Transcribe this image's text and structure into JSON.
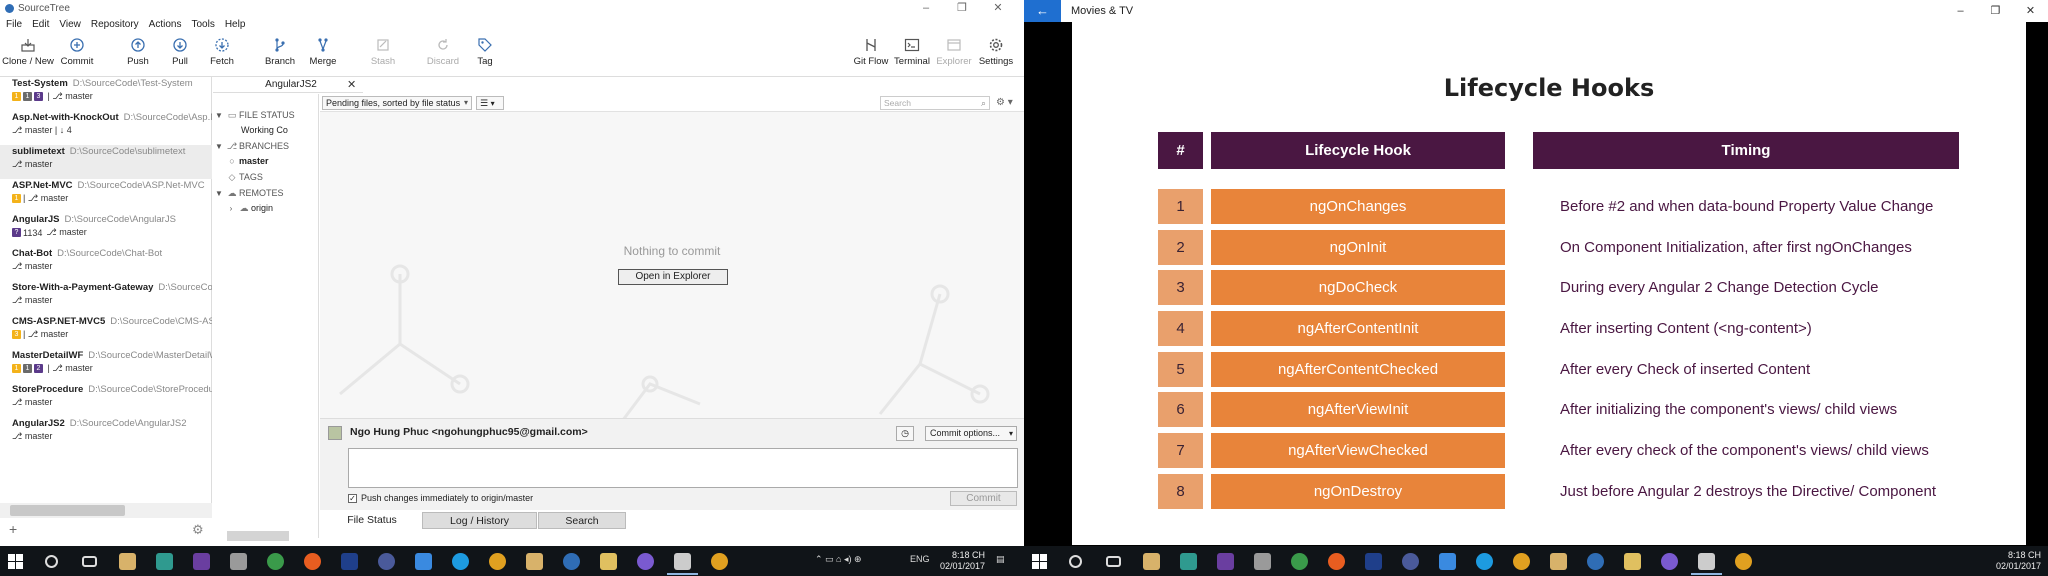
{
  "sourcetree": {
    "window_title": "SourceTree",
    "window_controls": [
      "–",
      "❐",
      "✕"
    ],
    "menu": [
      "File",
      "Edit",
      "View",
      "Repository",
      "Actions",
      "Tools",
      "Help"
    ],
    "toolbar": {
      "left": [
        {
          "label": "Clone / New",
          "icon": "clone-icon"
        },
        {
          "label": "Commit",
          "icon": "commit-icon"
        },
        {
          "label": "Push",
          "icon": "push-icon"
        },
        {
          "label": "Pull",
          "icon": "pull-icon"
        },
        {
          "label": "Fetch",
          "icon": "fetch-icon"
        },
        {
          "label": "Branch",
          "icon": "branch-icon"
        },
        {
          "label": "Merge",
          "icon": "merge-icon"
        },
        {
          "label": "Stash",
          "icon": "stash-icon",
          "disabled": true
        },
        {
          "label": "Discard",
          "icon": "discard-icon",
          "disabled": true
        },
        {
          "label": "Tag",
          "icon": "tag-icon"
        }
      ],
      "right": [
        {
          "label": "Git Flow",
          "icon": "gitflow-icon"
        },
        {
          "label": "Terminal",
          "icon": "terminal-icon"
        },
        {
          "label": "Explorer",
          "icon": "explorer-icon",
          "disabled": true
        },
        {
          "label": "Settings",
          "icon": "settings-icon"
        }
      ]
    },
    "repos": [
      {
        "name": "Test-System",
        "path": "D:\\SourceCode\\Test-System",
        "badges": [
          {
            "c": "y",
            "t": "1"
          },
          {
            "c": "g",
            "t": "1"
          },
          {
            "c": "p",
            "t": "3"
          }
        ],
        "num": "",
        "branch": "master"
      },
      {
        "name": "Asp.Net-with-KnockOut",
        "path": "D:\\SourceCode\\Asp.Ne",
        "badges": [],
        "num": "",
        "branch": "master | ↓ 4"
      },
      {
        "name": "sublimetext",
        "path": "D:\\SourceCode\\sublimetext",
        "badges": [],
        "num": "",
        "branch": "master",
        "selected": true
      },
      {
        "name": "ASP.Net-MVC",
        "path": "D:\\SourceCode\\ASP.Net-MVC",
        "badges": [
          {
            "c": "y",
            "t": "1"
          }
        ],
        "num": "",
        "branch": "master"
      },
      {
        "name": "AngularJS",
        "path": "D:\\SourceCode\\AngularJS",
        "badges": [
          {
            "c": "p",
            "t": "?"
          }
        ],
        "num": "1134",
        "branch": "master"
      },
      {
        "name": "Chat-Bot",
        "path": "D:\\SourceCode\\Chat-Bot",
        "badges": [],
        "num": "",
        "branch": "master"
      },
      {
        "name": "Store-With-a-Payment-Gateway",
        "path": "D:\\SourceCode",
        "badges": [],
        "num": "",
        "branch": "master"
      },
      {
        "name": "CMS-ASP.NET-MVC5",
        "path": "D:\\SourceCode\\CMS-ASP.N",
        "badges": [
          {
            "c": "y",
            "t": "3"
          }
        ],
        "num": "",
        "branch": "master"
      },
      {
        "name": "MasterDetailWF",
        "path": "D:\\SourceCode\\MasterDetailWF",
        "badges": [
          {
            "c": "y",
            "t": "1"
          },
          {
            "c": "g",
            "t": "1"
          },
          {
            "c": "p",
            "t": "2"
          }
        ],
        "num": "",
        "branch": "master"
      },
      {
        "name": "StoreProcedure",
        "path": "D:\\SourceCode\\StoreProcedure",
        "badges": [],
        "num": "",
        "branch": "master"
      },
      {
        "name": "AngularJS2",
        "path": "D:\\SourceCode\\AngularJS2",
        "badges": [],
        "num": "",
        "branch": "master"
      }
    ],
    "tab": {
      "title": "AngularJS2",
      "close": "✕"
    },
    "sidebar": {
      "file_status": "FILE STATUS",
      "working_copy": "Working Co",
      "branches": "BRANCHES",
      "master": "master",
      "tags": "TAGS",
      "remotes": "REMOTES",
      "origin": "origin"
    },
    "main": {
      "sort_select": "Pending files, sorted by file status",
      "view_select": "☰",
      "search_placeholder": "Search",
      "nothing_text": "Nothing to commit",
      "open_explorer": "Open in Explorer"
    },
    "commit": {
      "author": "Ngo Hung Phuc <ngohungphuc95@gmail.com>",
      "options": "Commit options...",
      "push_label": "Push changes immediately to origin/master",
      "push_checked": "✓",
      "commit_button": "Commit"
    },
    "bottom_tabs": [
      "File Status",
      "Log / History",
      "Search"
    ]
  },
  "movies": {
    "app_title": "Movies & TV",
    "back": "←",
    "window_controls": [
      "–",
      "❐",
      "✕"
    ],
    "slide": {
      "title": "Lifecycle Hooks",
      "headers": {
        "num": "#",
        "hook": "Lifecycle Hook",
        "timing": "Timing"
      },
      "rows": [
        {
          "num": "1",
          "hook": "ngOnChanges",
          "timing": "Before #2 and when data-bound Property Value Change"
        },
        {
          "num": "2",
          "hook": "ngOnInit",
          "timing": "On Component Initialization, after first ngOnChanges"
        },
        {
          "num": "3",
          "hook": "ngDoCheck",
          "timing": "During every Angular 2 Change Detection Cycle"
        },
        {
          "num": "4",
          "hook": "ngAfterContentInit",
          "timing": "After inserting Content (<ng-content>)"
        },
        {
          "num": "5",
          "hook": "ngAfterContentChecked",
          "timing": "After every Check of inserted Content"
        },
        {
          "num": "6",
          "hook": "ngAfterViewInit",
          "timing": "After initializing the component's views/ child views"
        },
        {
          "num": "7",
          "hook": "ngAfterViewChecked",
          "timing": "After every check of the component's views/ child views"
        },
        {
          "num": "8",
          "hook": "ngOnDestroy",
          "timing": "Just before Angular 2 destroys the Directive/ Component"
        }
      ]
    }
  },
  "taskbar_left": {
    "tray": "ENG",
    "time": "8:18 CH",
    "date": "02/01/2017"
  },
  "taskbar_right": {
    "time": "8:18 CH",
    "date": "02/01/2017"
  }
}
